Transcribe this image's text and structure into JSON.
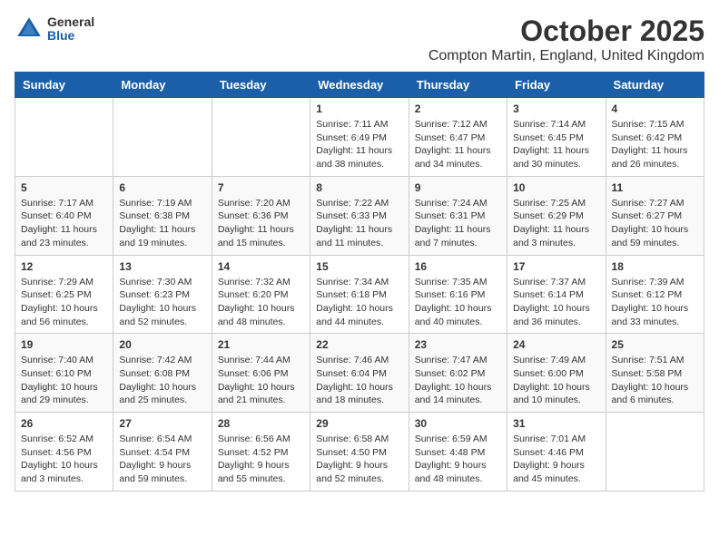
{
  "logo": {
    "general": "General",
    "blue": "Blue"
  },
  "title": "October 2025",
  "subtitle": "Compton Martin, England, United Kingdom",
  "weekdays": [
    "Sunday",
    "Monday",
    "Tuesday",
    "Wednesday",
    "Thursday",
    "Friday",
    "Saturday"
  ],
  "weeks": [
    [
      {
        "day": "",
        "info": ""
      },
      {
        "day": "",
        "info": ""
      },
      {
        "day": "",
        "info": ""
      },
      {
        "day": "1",
        "info": "Sunrise: 7:11 AM\nSunset: 6:49 PM\nDaylight: 11 hours\nand 38 minutes."
      },
      {
        "day": "2",
        "info": "Sunrise: 7:12 AM\nSunset: 6:47 PM\nDaylight: 11 hours\nand 34 minutes."
      },
      {
        "day": "3",
        "info": "Sunrise: 7:14 AM\nSunset: 6:45 PM\nDaylight: 11 hours\nand 30 minutes."
      },
      {
        "day": "4",
        "info": "Sunrise: 7:15 AM\nSunset: 6:42 PM\nDaylight: 11 hours\nand 26 minutes."
      }
    ],
    [
      {
        "day": "5",
        "info": "Sunrise: 7:17 AM\nSunset: 6:40 PM\nDaylight: 11 hours\nand 23 minutes."
      },
      {
        "day": "6",
        "info": "Sunrise: 7:19 AM\nSunset: 6:38 PM\nDaylight: 11 hours\nand 19 minutes."
      },
      {
        "day": "7",
        "info": "Sunrise: 7:20 AM\nSunset: 6:36 PM\nDaylight: 11 hours\nand 15 minutes."
      },
      {
        "day": "8",
        "info": "Sunrise: 7:22 AM\nSunset: 6:33 PM\nDaylight: 11 hours\nand 11 minutes."
      },
      {
        "day": "9",
        "info": "Sunrise: 7:24 AM\nSunset: 6:31 PM\nDaylight: 11 hours\nand 7 minutes."
      },
      {
        "day": "10",
        "info": "Sunrise: 7:25 AM\nSunset: 6:29 PM\nDaylight: 11 hours\nand 3 minutes."
      },
      {
        "day": "11",
        "info": "Sunrise: 7:27 AM\nSunset: 6:27 PM\nDaylight: 10 hours\nand 59 minutes."
      }
    ],
    [
      {
        "day": "12",
        "info": "Sunrise: 7:29 AM\nSunset: 6:25 PM\nDaylight: 10 hours\nand 56 minutes."
      },
      {
        "day": "13",
        "info": "Sunrise: 7:30 AM\nSunset: 6:23 PM\nDaylight: 10 hours\nand 52 minutes."
      },
      {
        "day": "14",
        "info": "Sunrise: 7:32 AM\nSunset: 6:20 PM\nDaylight: 10 hours\nand 48 minutes."
      },
      {
        "day": "15",
        "info": "Sunrise: 7:34 AM\nSunset: 6:18 PM\nDaylight: 10 hours\nand 44 minutes."
      },
      {
        "day": "16",
        "info": "Sunrise: 7:35 AM\nSunset: 6:16 PM\nDaylight: 10 hours\nand 40 minutes."
      },
      {
        "day": "17",
        "info": "Sunrise: 7:37 AM\nSunset: 6:14 PM\nDaylight: 10 hours\nand 36 minutes."
      },
      {
        "day": "18",
        "info": "Sunrise: 7:39 AM\nSunset: 6:12 PM\nDaylight: 10 hours\nand 33 minutes."
      }
    ],
    [
      {
        "day": "19",
        "info": "Sunrise: 7:40 AM\nSunset: 6:10 PM\nDaylight: 10 hours\nand 29 minutes."
      },
      {
        "day": "20",
        "info": "Sunrise: 7:42 AM\nSunset: 6:08 PM\nDaylight: 10 hours\nand 25 minutes."
      },
      {
        "day": "21",
        "info": "Sunrise: 7:44 AM\nSunset: 6:06 PM\nDaylight: 10 hours\nand 21 minutes."
      },
      {
        "day": "22",
        "info": "Sunrise: 7:46 AM\nSunset: 6:04 PM\nDaylight: 10 hours\nand 18 minutes."
      },
      {
        "day": "23",
        "info": "Sunrise: 7:47 AM\nSunset: 6:02 PM\nDaylight: 10 hours\nand 14 minutes."
      },
      {
        "day": "24",
        "info": "Sunrise: 7:49 AM\nSunset: 6:00 PM\nDaylight: 10 hours\nand 10 minutes."
      },
      {
        "day": "25",
        "info": "Sunrise: 7:51 AM\nSunset: 5:58 PM\nDaylight: 10 hours\nand 6 minutes."
      }
    ],
    [
      {
        "day": "26",
        "info": "Sunrise: 6:52 AM\nSunset: 4:56 PM\nDaylight: 10 hours\nand 3 minutes."
      },
      {
        "day": "27",
        "info": "Sunrise: 6:54 AM\nSunset: 4:54 PM\nDaylight: 9 hours\nand 59 minutes."
      },
      {
        "day": "28",
        "info": "Sunrise: 6:56 AM\nSunset: 4:52 PM\nDaylight: 9 hours\nand 55 minutes."
      },
      {
        "day": "29",
        "info": "Sunrise: 6:58 AM\nSunset: 4:50 PM\nDaylight: 9 hours\nand 52 minutes."
      },
      {
        "day": "30",
        "info": "Sunrise: 6:59 AM\nSunset: 4:48 PM\nDaylight: 9 hours\nand 48 minutes."
      },
      {
        "day": "31",
        "info": "Sunrise: 7:01 AM\nSunset: 4:46 PM\nDaylight: 9 hours\nand 45 minutes."
      },
      {
        "day": "",
        "info": ""
      }
    ]
  ]
}
